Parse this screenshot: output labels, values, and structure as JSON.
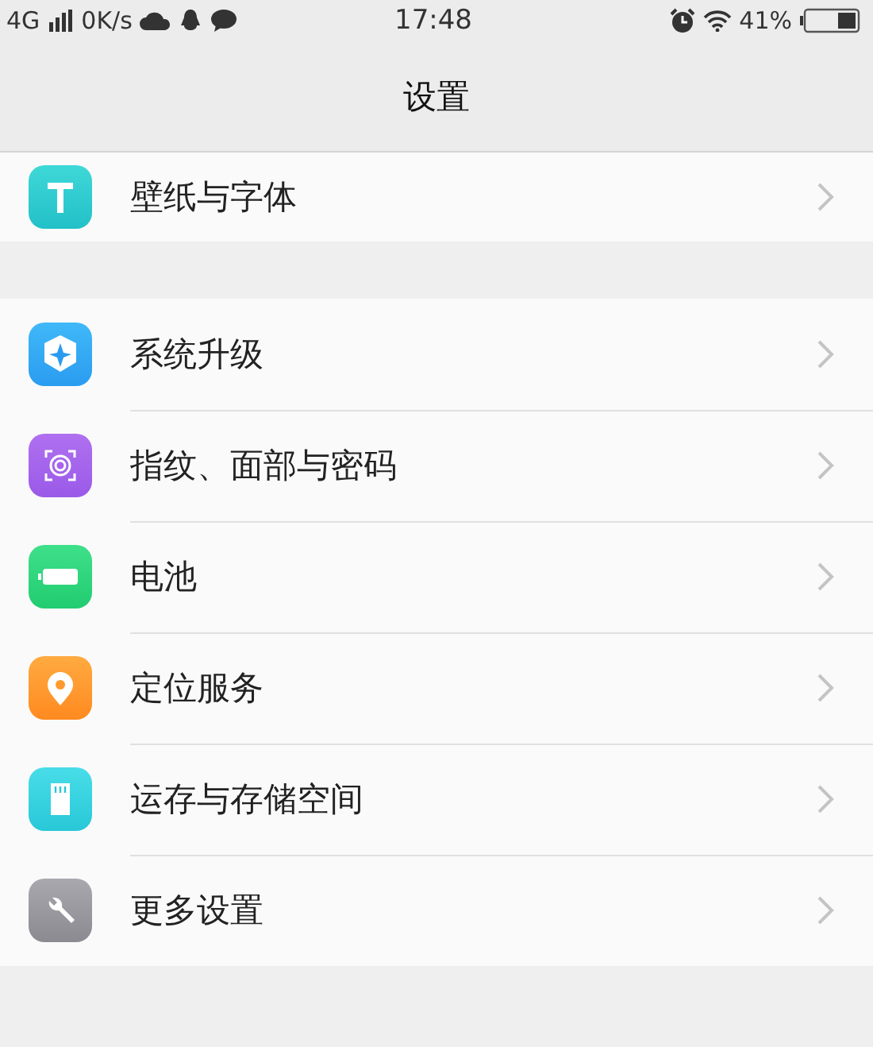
{
  "status_bar": {
    "network": "4G",
    "speed": "0K/s",
    "time": "17:48",
    "battery": "41%"
  },
  "header": {
    "title": "设置"
  },
  "groups": [
    {
      "items": [
        {
          "label": "壁纸与字体",
          "kind": "font"
        }
      ]
    },
    {
      "items": [
        {
          "label": "系统升级",
          "kind": "update"
        },
        {
          "label": "指纹、面部与密码",
          "kind": "fingerprint"
        },
        {
          "label": "电池",
          "kind": "battery"
        },
        {
          "label": "定位服务",
          "kind": "location"
        },
        {
          "label": "运存与存储空间",
          "kind": "storage"
        },
        {
          "label": "更多设置",
          "kind": "more"
        }
      ]
    }
  ]
}
